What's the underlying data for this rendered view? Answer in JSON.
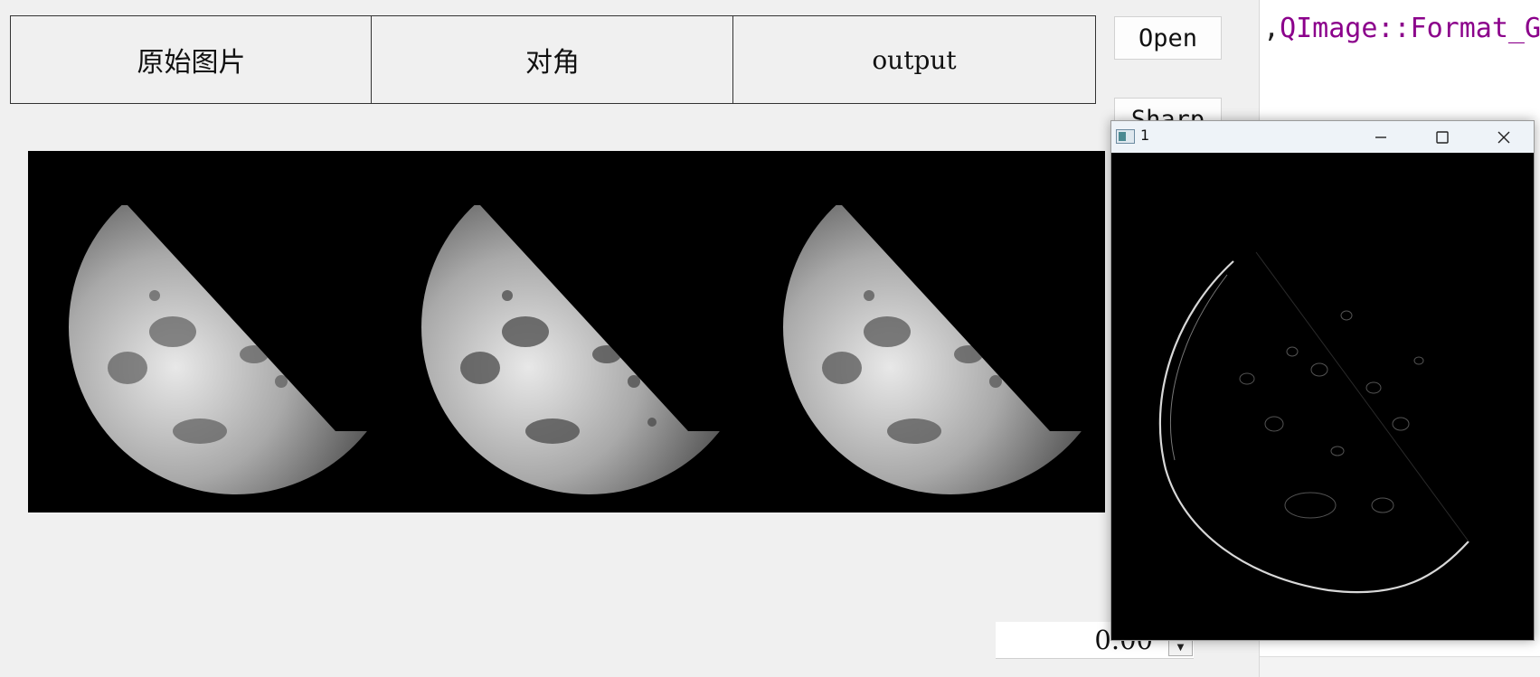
{
  "tabs": [
    {
      "label": "原始图片"
    },
    {
      "label": "对角"
    },
    {
      "label": "output"
    }
  ],
  "buttons": {
    "open": "Open",
    "sharp": "Sharp"
  },
  "code_snippet": {
    "punct": ",",
    "text": "QImage::Format_G"
  },
  "spin_box": {
    "value": "0.00"
  },
  "popup_window": {
    "title": "1"
  }
}
